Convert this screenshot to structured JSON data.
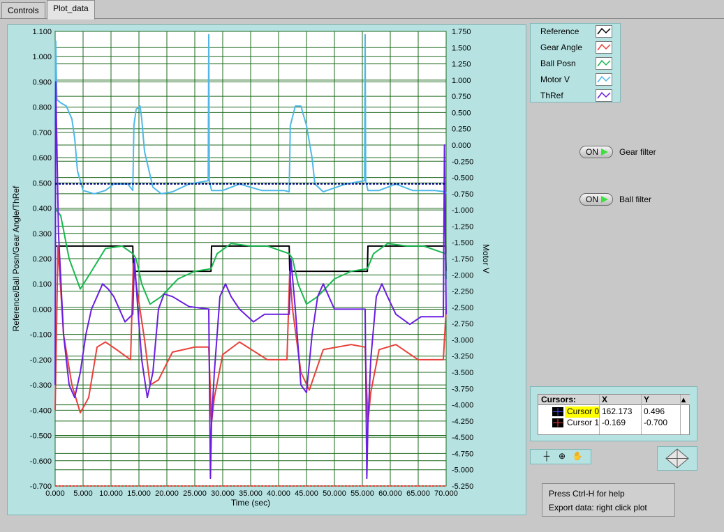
{
  "tabs": [
    {
      "label": "Controls",
      "active": false
    },
    {
      "label": "Plot_data",
      "active": true
    }
  ],
  "graph": {
    "xlabel": "Time (sec)",
    "ylabel_left": "Reference/Ball Posn/Gear Angle/ThRef",
    "ylabel_right": "Motor V",
    "x_ticks": [
      "0.000",
      "5.000",
      "10.000",
      "15.000",
      "20.000",
      "25.000",
      "30.000",
      "35.000",
      "40.000",
      "45.000",
      "50.000",
      "55.000",
      "60.000",
      "65.000",
      "70.000"
    ],
    "y_left_ticks": [
      "1.100",
      "1.000",
      "0.900",
      "0.800",
      "0.700",
      "0.600",
      "0.500",
      "0.400",
      "0.300",
      "0.200",
      "0.100",
      "0.000",
      "-0.100",
      "-0.200",
      "-0.300",
      "-0.400",
      "-0.500",
      "-0.600",
      "-0.700"
    ],
    "y_right_ticks": [
      "1.750",
      "1.500",
      "1.250",
      "1.000",
      "0.750",
      "0.500",
      "0.250",
      "0.000",
      "-0.250",
      "-0.500",
      "-0.750",
      "-1.000",
      "-1.250",
      "-1.500",
      "-1.750",
      "-2.000",
      "-2.250",
      "-2.500",
      "-2.750",
      "-3.000",
      "-3.250",
      "-3.500",
      "-3.750",
      "-4.000",
      "-4.250",
      "-4.500",
      "-4.750",
      "-5.000",
      "-5.250"
    ]
  },
  "legend": [
    {
      "label": "Reference",
      "color": "#000000"
    },
    {
      "label": "Gear Angle",
      "color": "#e8403a"
    },
    {
      "label": "Ball Posn",
      "color": "#19b850"
    },
    {
      "label": "Motor V",
      "color": "#4fb8e8"
    },
    {
      "label": "ThRef",
      "color": "#6a1ee0"
    }
  ],
  "controls": {
    "gear_filter": {
      "state": "ON",
      "label": "Gear filter"
    },
    "ball_filter": {
      "state": "ON",
      "label": "Ball filter"
    }
  },
  "cursors": {
    "title": "Cursors:",
    "col_x": "X",
    "col_y": "Y",
    "rows": [
      {
        "name": "Cursor 0",
        "x": "162.173",
        "y": "0.496",
        "highlight": "#ffff00"
      },
      {
        "name": "Cursor 1",
        "x": "-0.169",
        "y": "-0.700",
        "highlight": ""
      }
    ]
  },
  "help": {
    "line1": "Press Ctrl-H for help",
    "line2": "Export data: right click plot"
  },
  "chart_data": {
    "type": "line",
    "xlabel": "Time (sec)",
    "ylabel": "Reference/Ball Posn/Gear Angle/ThRef",
    "y2label": "Motor V",
    "xlim": [
      0,
      70
    ],
    "ylim": [
      -0.7,
      1.1
    ],
    "y2lim": [
      -5.25,
      1.75
    ],
    "grid": true,
    "legend_position": "top-right-outside",
    "series": [
      {
        "name": "Reference",
        "color": "#000000",
        "axis": "left",
        "x": [
          0,
          0.1,
          13.9,
          14.0,
          27.9,
          28.0,
          41.9,
          42.0,
          55.9,
          56.0,
          69.9,
          70.0
        ],
        "y": [
          0.25,
          0.25,
          0.25,
          0.15,
          0.15,
          0.25,
          0.25,
          0.15,
          0.15,
          0.25,
          0.25,
          0.15
        ]
      },
      {
        "name": "Gear Angle",
        "color": "#e8403a",
        "axis": "left",
        "x": [
          0,
          0.5,
          1.5,
          3,
          4.5,
          6,
          7.5,
          9,
          11,
          13.5,
          14,
          14.5,
          16,
          17,
          18.5,
          21,
          25,
          27.5,
          28,
          28.5,
          30,
          33,
          38,
          41.5,
          42,
          42.5,
          44,
          45.5,
          48,
          53,
          55.5,
          56,
          56.5,
          58,
          61,
          65,
          69.5,
          70
        ],
        "y": [
          -0.4,
          0.25,
          -0.1,
          -0.3,
          -0.41,
          -0.35,
          -0.15,
          -0.13,
          -0.16,
          -0.2,
          0.18,
          0.1,
          -0.12,
          -0.3,
          -0.28,
          -0.17,
          -0.15,
          -0.15,
          -0.45,
          -0.35,
          -0.18,
          -0.13,
          -0.2,
          -0.2,
          0.15,
          0.0,
          -0.25,
          -0.32,
          -0.16,
          -0.14,
          -0.15,
          -0.45,
          -0.33,
          -0.16,
          -0.14,
          -0.2,
          -0.2,
          0.0
        ]
      },
      {
        "name": "Ball Posn",
        "color": "#19b850",
        "axis": "left",
        "x": [
          0,
          1,
          2.5,
          4.5,
          6.5,
          9,
          12,
          13.9,
          14.5,
          15.5,
          17,
          19,
          22,
          25,
          27.9,
          29,
          31.5,
          35,
          38,
          41.9,
          42.5,
          43.5,
          45,
          47,
          50,
          53,
          55.9,
          57,
          59.5,
          63,
          66,
          69.9,
          70
        ],
        "y": [
          0.4,
          0.37,
          0.2,
          0.08,
          0.15,
          0.24,
          0.25,
          0.22,
          0.2,
          0.1,
          0.02,
          0.05,
          0.12,
          0.15,
          0.16,
          0.22,
          0.26,
          0.25,
          0.25,
          0.22,
          0.2,
          0.1,
          0.02,
          0.05,
          0.12,
          0.15,
          0.16,
          0.22,
          0.26,
          0.25,
          0.25,
          0.22,
          0.12
        ]
      },
      {
        "name": "Motor V",
        "color": "#4fb8e8",
        "axis": "right",
        "x": [
          0,
          0.1,
          0.3,
          1,
          2,
          3,
          3.5,
          4,
          5,
          7,
          9,
          10.5,
          13,
          13.9,
          14.1,
          14.5,
          15.2,
          15.5,
          16,
          17.5,
          19,
          21,
          24,
          27.4,
          27.5,
          27.6,
          28,
          30,
          33,
          37,
          41,
          41.9,
          42.1,
          43,
          44,
          45,
          46,
          46.5,
          48,
          52,
          55.4,
          55.5,
          55.6,
          56,
          58,
          61,
          64,
          68,
          69.9,
          70
        ],
        "y": [
          0.3,
          1.6,
          0.7,
          0.65,
          0.6,
          0.4,
          0.1,
          -0.4,
          -0.7,
          -0.75,
          -0.7,
          -0.6,
          -0.6,
          -0.7,
          0.3,
          0.55,
          0.6,
          0.4,
          -0.1,
          -0.65,
          -0.75,
          -0.72,
          -0.6,
          -0.55,
          1.7,
          -0.55,
          -0.7,
          -0.7,
          -0.6,
          -0.7,
          -0.7,
          -0.72,
          0.3,
          0.6,
          0.6,
          0.3,
          -0.2,
          -0.6,
          -0.72,
          -0.6,
          -0.55,
          1.7,
          -0.55,
          -0.7,
          -0.7,
          -0.6,
          -0.7,
          -0.7,
          -0.72,
          -0.75
        ]
      },
      {
        "name": "ThRef",
        "color": "#6a1ee0",
        "axis": "left",
        "x": [
          0,
          0.1,
          0.6,
          1.5,
          2.5,
          3.5,
          4.5,
          5.5,
          6.5,
          7.5,
          8.5,
          9.5,
          10.5,
          11.5,
          12.5,
          13.9,
          14.2,
          14.8,
          15.5,
          16.5,
          17.5,
          18.5,
          19.5,
          21,
          24,
          27.5,
          27.8,
          28,
          28.5,
          29.5,
          30.5,
          31.5,
          33,
          35.5,
          37.5,
          40,
          41.9,
          42.2,
          43,
          44,
          45,
          46,
          47,
          48,
          49,
          50,
          52,
          55.5,
          55.8,
          56,
          56.5,
          57.5,
          58.5,
          59.5,
          61,
          63.5,
          65.5,
          69.5,
          69.7,
          70
        ],
        "y": [
          -0.3,
          0.9,
          0.3,
          -0.1,
          -0.3,
          -0.35,
          -0.25,
          -0.1,
          0.0,
          0.05,
          0.1,
          0.08,
          0.05,
          0.0,
          -0.05,
          -0.02,
          0.2,
          0.0,
          -0.2,
          -0.35,
          -0.25,
          0.0,
          0.06,
          0.05,
          0.01,
          0.0,
          -0.67,
          -0.45,
          -0.25,
          0.05,
          0.1,
          0.05,
          0.0,
          -0.05,
          -0.02,
          -0.02,
          -0.02,
          0.2,
          0.0,
          -0.3,
          -0.33,
          -0.1,
          0.05,
          0.1,
          0.05,
          0.0,
          0.0,
          0.0,
          -0.67,
          -0.45,
          -0.2,
          0.05,
          0.1,
          0.05,
          -0.02,
          -0.06,
          -0.03,
          -0.03,
          0.65,
          -0.02
        ]
      }
    ],
    "cursor_lines": [
      {
        "name": "Cursor 0",
        "axis": "left",
        "y": 0.496,
        "color": "#000080"
      },
      {
        "name": "Cursor 1",
        "axis": "left",
        "y": -0.7,
        "color": "#e8403a"
      }
    ]
  }
}
